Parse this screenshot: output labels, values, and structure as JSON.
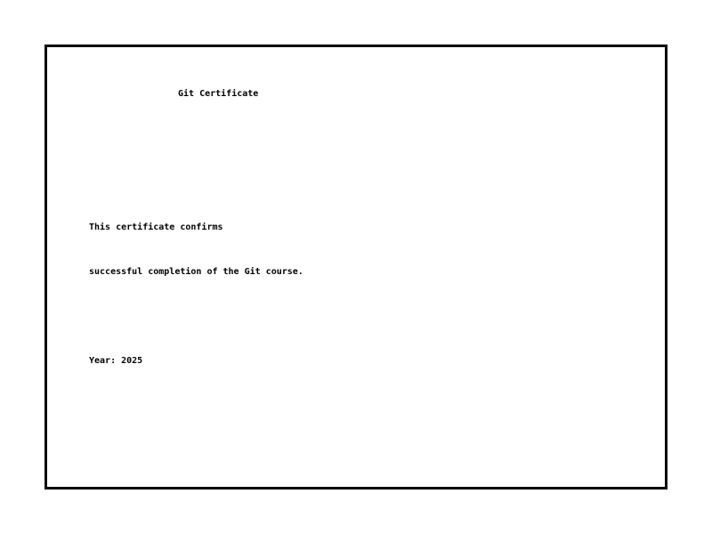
{
  "certificate": {
    "title": "Git Certificate",
    "body_line_1": "This certificate confirms",
    "body_line_2": "successful completion of the Git course.",
    "year_label": "Year: 2025"
  },
  "colors": {
    "border": "#000000",
    "background": "#ffffff",
    "text": "#000000"
  }
}
